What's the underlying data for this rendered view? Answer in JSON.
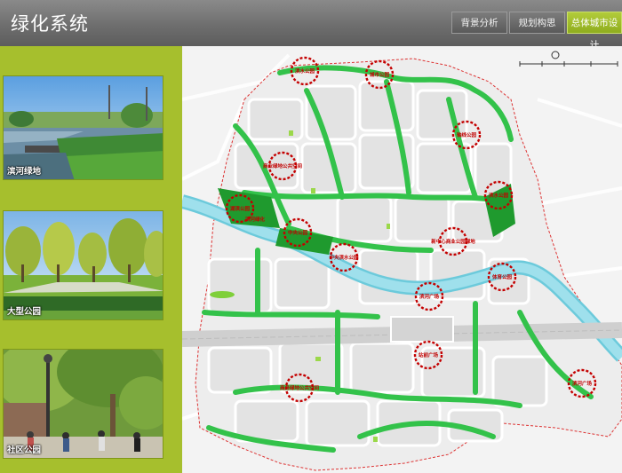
{
  "header": {
    "title": "绿化系统",
    "tabs": [
      {
        "label": "背景分析"
      },
      {
        "label": "规划构思"
      },
      {
        "label": "总体城市设计"
      }
    ]
  },
  "sidebar": {
    "photos": [
      {
        "caption": "滨河绿地"
      },
      {
        "caption": "大型公园"
      },
      {
        "caption": "社区公园"
      }
    ]
  },
  "map": {
    "labels": [
      {
        "text": "滨水公园"
      },
      {
        "text": "城市公园"
      },
      {
        "text": "轴线公园"
      },
      {
        "text": "商业绿地公共空间"
      },
      {
        "text": "滨水公园"
      },
      {
        "text": "湖滨公园"
      },
      {
        "text": "中央公园"
      },
      {
        "text": "中央滨水公园"
      },
      {
        "text": "滨河绿化"
      },
      {
        "text": "新中心商业公园绿地"
      },
      {
        "text": "体育公园"
      },
      {
        "text": "滨河广场"
      },
      {
        "text": "站前广场"
      },
      {
        "text": "商务绿地公共空间"
      },
      {
        "text": "滨河广场"
      }
    ],
    "colors": {
      "green": "#33c24a",
      "dark_green": "#1f9a2e",
      "water": "#9fe0ec",
      "water_edge": "#6ccadb",
      "circle": "#c40000",
      "block": "#eaeaea"
    }
  }
}
